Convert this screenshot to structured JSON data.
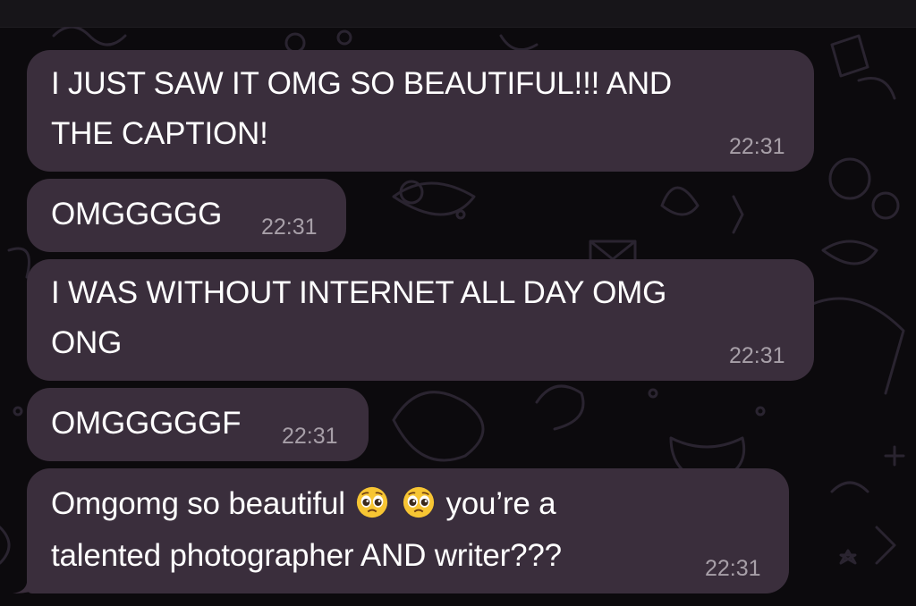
{
  "chat": {
    "messages": [
      {
        "line1": "I JUST SAW IT OMG SO BEAUTIFUL!!! AND",
        "line2": "THE CAPTION!",
        "time": "22:31"
      },
      {
        "line1": "OMGGGGG",
        "time": "22:31"
      },
      {
        "line1": "I WAS WITHOUT INTERNET ALL DAY OMG",
        "line2": "ONG",
        "time": "22:31"
      },
      {
        "line1": "OMGGGGGF",
        "time": "22:31"
      },
      {
        "line1_before": "Omgomg so beautiful",
        "line1_emoji": "pleading-face-emoji",
        "line1_after": "you’re a",
        "line2": "talented photographer AND writer???",
        "time": "22:31"
      }
    ]
  },
  "colors": {
    "background": "#0c0a0d",
    "bubble": "#3a2e3c",
    "text": "#ffffff",
    "timestamp": "#a79fa8",
    "doodle": "#2a2430"
  }
}
